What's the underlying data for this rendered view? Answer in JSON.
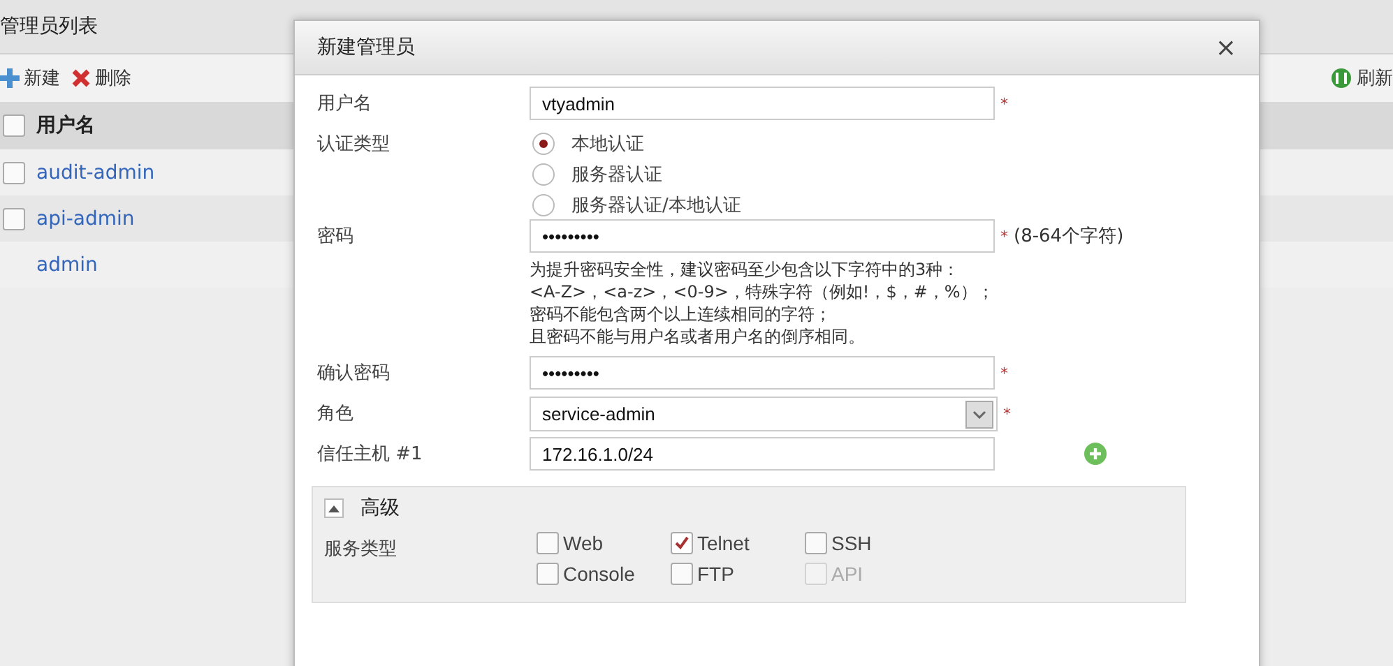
{
  "page": {
    "title": "管理员列表",
    "toolbar": [
      {
        "kind": "add",
        "label": "新建"
      },
      {
        "kind": "delete",
        "label": "删除"
      }
    ],
    "refresh": {
      "label": "刷新"
    },
    "table": {
      "header": "用户名",
      "header_checked": false,
      "rows": [
        {
          "name": "audit-admin",
          "checked": false
        },
        {
          "name": "api-admin",
          "checked": false
        },
        {
          "name": "admin"
        }
      ]
    }
  },
  "dialog": {
    "title": "新建管理员",
    "close": "×",
    "username": {
      "label": "用户名",
      "value": "vtyadmin",
      "required": "*"
    },
    "auth": {
      "label": "认证类型",
      "options": [
        {
          "label": "本地认证",
          "selected": true
        },
        {
          "label": "服务器认证",
          "selected": false
        },
        {
          "label": "服务器认证/本地认证",
          "selected": false
        }
      ]
    },
    "password": {
      "label": "密码",
      "value": "•••••••••",
      "required": "*",
      "note": "(8-64个字符)",
      "hints": [
        "为提升密码安全性，建议密码至少包含以下字符中的3种：",
        "<A-Z>，<a-z>，<0-9>，特殊字符（例如!，$，#，%）；",
        "密码不能包含两个以上连续相同的字符；",
        "且密码不能与用户名或者用户名的倒序相同。"
      ]
    },
    "confirm": {
      "label": "确认密码",
      "value": "•••••••••",
      "required": "*"
    },
    "role": {
      "label": "角色",
      "value": "service-admin",
      "required": "*"
    },
    "trusted_host": {
      "label": "信任主机 #1",
      "value": "172.16.1.0/24"
    },
    "advanced": {
      "title": "高级",
      "expanded": true,
      "service_label": "服务类型",
      "services": [
        {
          "label": "Web",
          "checked": false,
          "disabled": false
        },
        {
          "label": "Telnet",
          "checked": true,
          "disabled": false
        },
        {
          "label": "SSH",
          "checked": false,
          "disabled": false
        },
        {
          "label": "Console",
          "checked": false,
          "disabled": false
        },
        {
          "label": "FTP",
          "checked": false,
          "disabled": false
        },
        {
          "label": "API",
          "checked": false,
          "disabled": true
        }
      ]
    }
  }
}
